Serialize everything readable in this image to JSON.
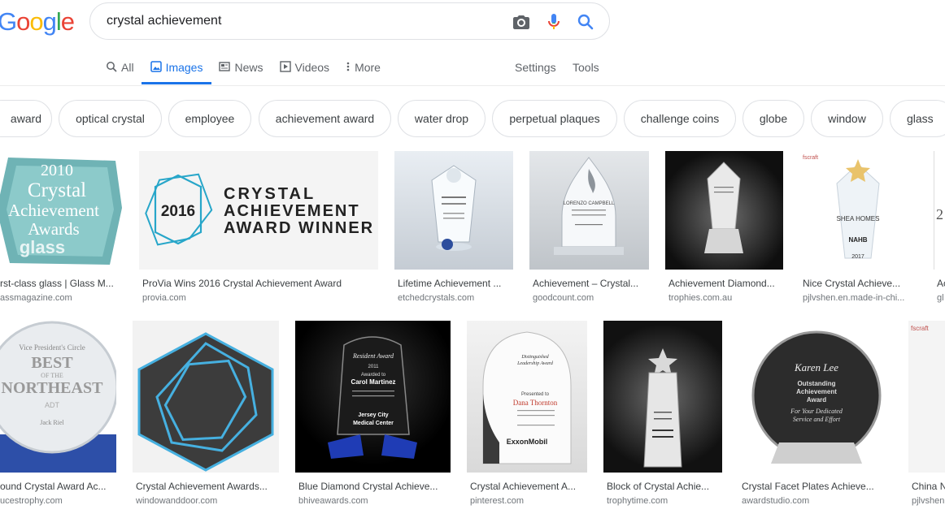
{
  "logo": {
    "letters": [
      "G",
      "o",
      "o",
      "g",
      "l",
      "e"
    ],
    "colors": [
      "#4285f4",
      "#ea4335",
      "#fbbc05",
      "#4285f4",
      "#34a853",
      "#ea4335"
    ]
  },
  "search": {
    "query": "crystal achievement",
    "camera_icon": "camera-icon",
    "mic_icon": "mic-icon",
    "search_icon": "search-icon"
  },
  "tabs": [
    {
      "label": "All",
      "icon": "search-icon",
      "active": false
    },
    {
      "label": "Images",
      "icon": "image-icon",
      "active": true
    },
    {
      "label": "News",
      "icon": "news-icon",
      "active": false
    },
    {
      "label": "Videos",
      "icon": "play-icon",
      "active": false
    },
    {
      "label": "More",
      "icon": "more-vert-icon",
      "active": false
    }
  ],
  "tools": {
    "settings": "Settings",
    "tools": "Tools"
  },
  "chips": [
    "award",
    "optical crystal",
    "employee",
    "achievement award",
    "water drop",
    "perpetual plaques",
    "challenge coins",
    "globe",
    "window",
    "glass"
  ],
  "row1": [
    {
      "title": "rst-class glass | Glass M...",
      "site": "assmagazine.com",
      "thumb_text": [
        "2010",
        "Crystal",
        "Achievement",
        "Awards",
        "glass"
      ]
    },
    {
      "title": "ProVia Wins 2016 Crystal Achievement Award",
      "site": "provia.com",
      "thumb_text": [
        "2016",
        "CRYSTAL",
        "ACHIEVEMENT",
        "AWARD WINNER"
      ]
    },
    {
      "title": "Lifetime Achievement ...",
      "site": "etchedcrystals.com"
    },
    {
      "title": "Achievement – Crystal...",
      "site": "goodcount.com"
    },
    {
      "title": "Achievement Diamond...",
      "site": "trophies.com.au"
    },
    {
      "title": "Nice Crystal Achieve...",
      "site": "pjlvshen.en.made-in-chi..."
    },
    {
      "title": "Ac",
      "site": "gl"
    }
  ],
  "row2": [
    {
      "title": "ound Crystal Award Ac...",
      "site": "ucestrophy.com"
    },
    {
      "title": "Crystal Achievement Awards...",
      "site": "windowanddoor.com"
    },
    {
      "title": "Blue Diamond Crystal Achieve...",
      "site": "bhiveawards.com"
    },
    {
      "title": "Crystal Achievement A...",
      "site": "pinterest.com"
    },
    {
      "title": "Block of Crystal Achie...",
      "site": "trophytime.com"
    },
    {
      "title": "Crystal Facet Plates Achieve...",
      "site": "awardstudio.com"
    },
    {
      "title": "China N",
      "site": "pjlvshen"
    }
  ],
  "thumb_labels": {
    "r1_4_top": "LORENZO CAMPBELL",
    "r2_1": [
      "Vice President's Circle",
      "BEST",
      "OF THE",
      "NORTHEAST",
      "ADT",
      "Jack Riel"
    ],
    "r2_3": [
      "Resident Award",
      "2011",
      "Awarded to",
      "Carol Martinez",
      "Jersey City",
      "Medical Center"
    ],
    "r2_4": [
      "Distinguished",
      "Leadership Award",
      "Presented to",
      "Dana Thornton",
      "ExxonMobil"
    ],
    "r2_6": [
      "Karen Lee",
      "Outstanding",
      "Achievement",
      "Award",
      "For Your Dedicated",
      "Service and Effort"
    ],
    "r1_6": [
      "SHEA HOMES",
      "NAHB",
      "2017"
    ]
  }
}
